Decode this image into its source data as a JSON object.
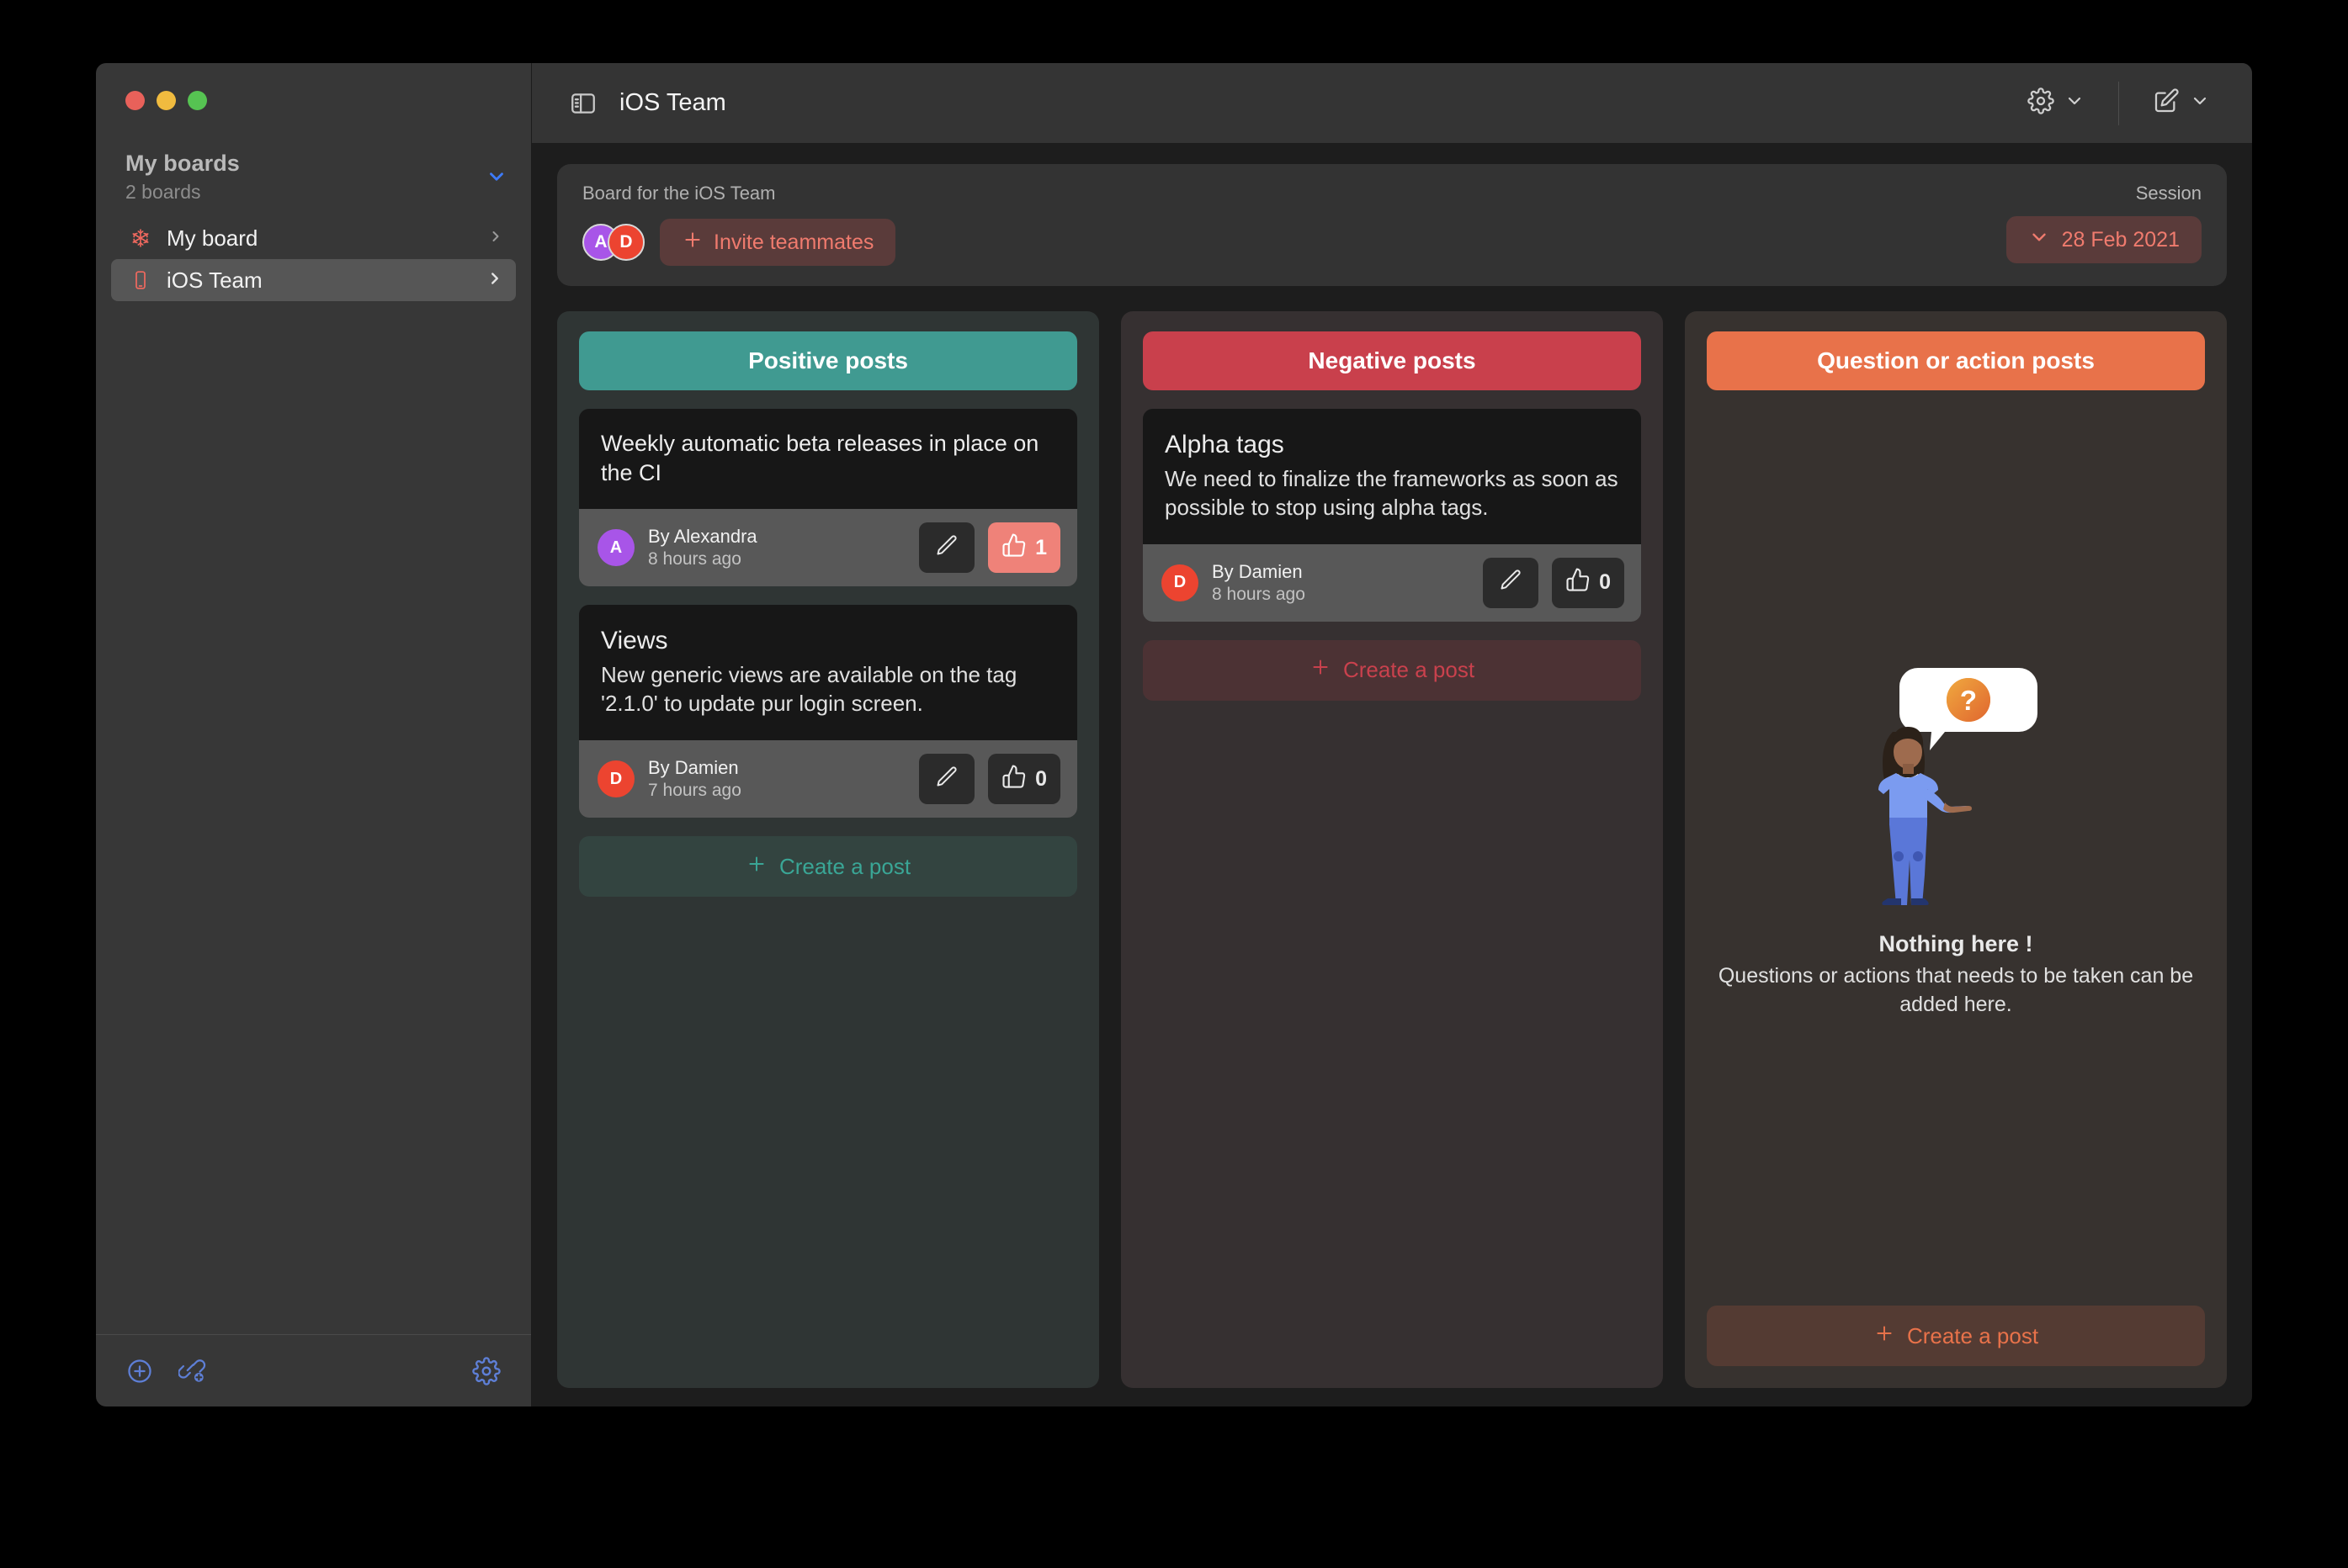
{
  "window": {
    "traffic_lights": [
      "close",
      "minimize",
      "zoom"
    ]
  },
  "sidebar": {
    "section_title": "My boards",
    "section_subtitle": "2 boards",
    "collapse_icon": "chevron-down-icon",
    "items": [
      {
        "label": "My board",
        "icon": "snowflake-icon",
        "selected": false
      },
      {
        "label": "iOS Team",
        "icon": "iphone-icon",
        "selected": true
      }
    ],
    "footer": {
      "add_board_icon": "plus-circle-icon",
      "join_link_icon": "link-add-icon",
      "settings_icon": "gear-icon"
    }
  },
  "titlebar": {
    "sidebar_toggle_icon": "sidebar-toggle-icon",
    "title": "iOS Team",
    "settings_icon": "gear-icon",
    "settings_chevron": "chevron-down-icon",
    "compose_icon": "compose-icon",
    "compose_chevron": "chevron-down-icon"
  },
  "board_bar": {
    "description": "Board for the iOS Team",
    "members": [
      {
        "initial": "A",
        "color": "#a855e8"
      },
      {
        "initial": "D",
        "color": "#ec4430"
      }
    ],
    "invite_label": "Invite teammates",
    "invite_icon": "plus-icon",
    "session_label": "Session",
    "session_value": "28 Feb 2021",
    "session_icon": "chevron-down-icon"
  },
  "columns": [
    {
      "title": "Positive posts",
      "header_color": "#409a91",
      "create_label": "Create a post",
      "create_icon": "plus-icon",
      "posts": [
        {
          "title": "Weekly automatic beta releases in place on the CI",
          "text": "",
          "author": "By Alexandra",
          "author_initial": "A",
          "author_color": "#a855e8",
          "time": "8 hours ago",
          "edit_icon": "pencil-icon",
          "like_icon": "thumbs-up-icon",
          "likes": "1",
          "liked": true
        },
        {
          "title": "Views",
          "text": "New generic views are available on the tag '2.1.0' to update pur login screen.",
          "author": "By Damien",
          "author_initial": "D",
          "author_color": "#ec4430",
          "time": "7 hours ago",
          "edit_icon": "pencil-icon",
          "like_icon": "thumbs-up-icon",
          "likes": "0",
          "liked": false
        }
      ]
    },
    {
      "title": "Negative posts",
      "header_color": "#c9404c",
      "create_label": "Create a post",
      "create_icon": "plus-icon",
      "posts": [
        {
          "title": "Alpha tags",
          "text": "We need to finalize the frameworks as soon as possible to stop using alpha tags.",
          "author": "By Damien",
          "author_initial": "D",
          "author_color": "#ec4430",
          "time": "8 hours ago",
          "edit_icon": "pencil-icon",
          "like_icon": "thumbs-up-icon",
          "likes": "0",
          "liked": false
        }
      ]
    },
    {
      "title": "Question or action posts",
      "header_color": "#e8724a",
      "create_label": "Create a post",
      "create_icon": "plus-icon",
      "posts": [],
      "empty_state": {
        "illustration": "person-with-question-bubble-illustration",
        "title": "Nothing here !",
        "description": "Questions or actions that needs to be taken can be added here."
      }
    }
  ]
}
